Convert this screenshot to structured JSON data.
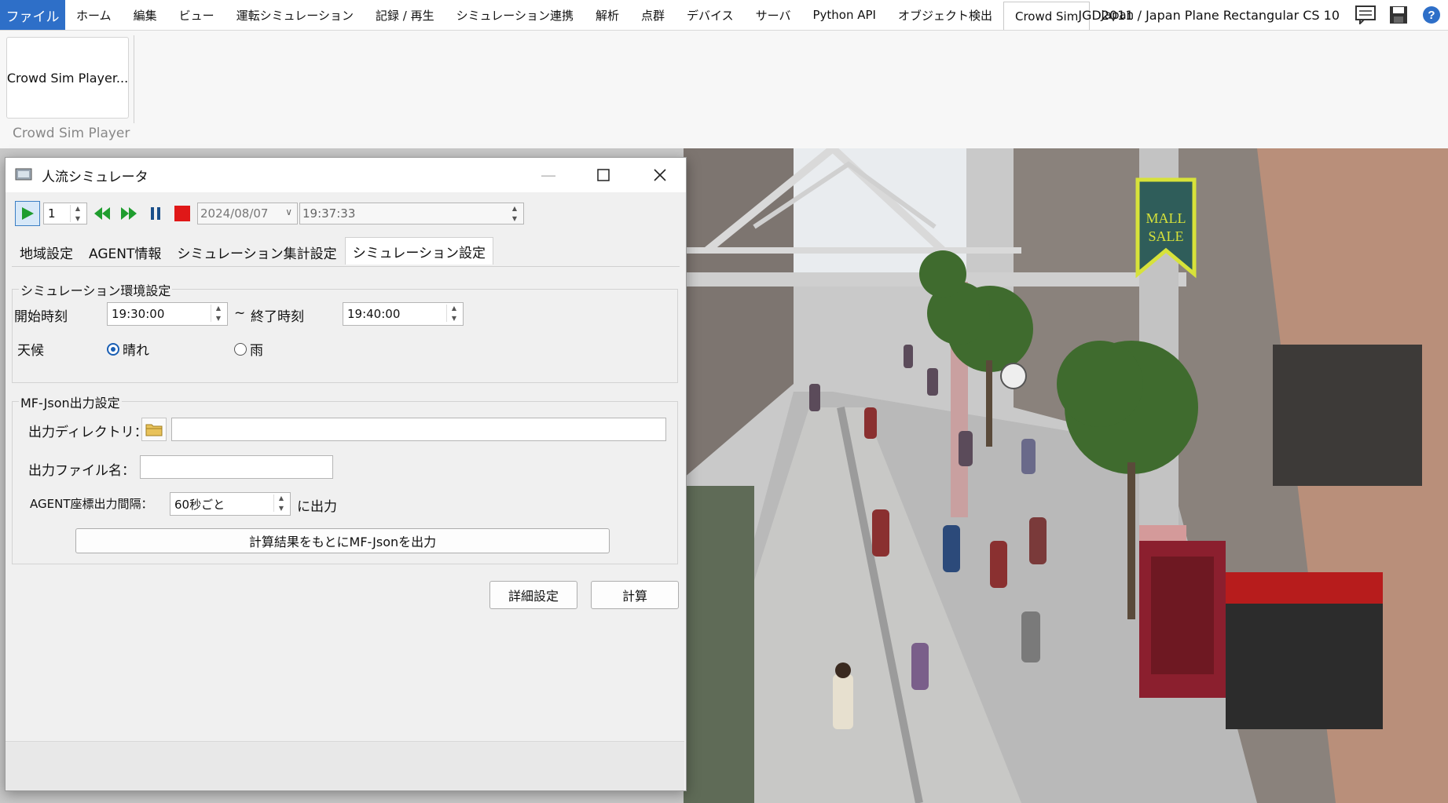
{
  "menu": {
    "file": "ファイル",
    "items": [
      "ホーム",
      "編集",
      "ビュー",
      "運転シミュレーション",
      "記録 / 再生",
      "シミュレーション連携",
      "解析",
      "点群",
      "デバイス",
      "サーバ",
      "Python API",
      "オブジェクト検出",
      "Crowd Sim"
    ],
    "active_index": 12,
    "region": "Japan",
    "crs": "JGD2011 / Japan Plane Rectangular CS 10"
  },
  "ribbon": {
    "button_label": "Crowd Sim Player...",
    "group_label": "Crowd Sim Player"
  },
  "dialog": {
    "title": "人流シミュレータ",
    "toolbar": {
      "speed": "1",
      "date": "2024/08/07",
      "time": "19:37:33"
    },
    "tabs": [
      "地域設定",
      "AGENT情報",
      "シミュレーション集計設定",
      "シミュレーション設定"
    ],
    "active_tab": 3,
    "env": {
      "title": "シミュレーション環境設定",
      "start_label": "開始時刻",
      "start_value": "19:30:00",
      "tilde": "~",
      "end_label": "終了時刻",
      "end_value": "19:40:00",
      "weather_label": "天候",
      "weather_sunny": "晴れ",
      "weather_rain": "雨",
      "weather_selected": "晴れ"
    },
    "mfjson": {
      "title": "MF-Json出力設定",
      "dir_label": "出力ディレクトリ：",
      "dir_value": "",
      "file_label": "出力ファイル名：",
      "file_value": "",
      "interval_label": "AGENT座標出力間隔：",
      "interval_value": "60秒ごと",
      "interval_suffix": "に出力",
      "export_button": "計算結果をもとにMF-Jsonを出力"
    },
    "buttons": {
      "advanced": "詳細設定",
      "calculate": "計算"
    }
  },
  "scene": {
    "banner_text_1": "MALL",
    "banner_text_2": "SALE"
  },
  "colors": {
    "file_tab": "#2e6fc8",
    "banner": "#2f5d5a",
    "banner_border": "#d7e23a"
  }
}
